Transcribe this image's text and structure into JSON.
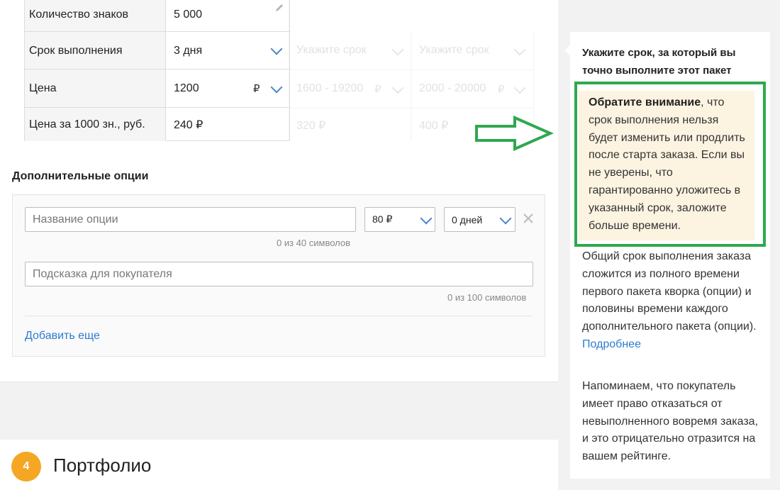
{
  "packages": {
    "rows": [
      {
        "label": "Количество знаков",
        "value": "5 000"
      },
      {
        "label": "Срок выполнения",
        "value": "3 дня"
      },
      {
        "label": "Цена",
        "value": "1200",
        "currency": "₽"
      },
      {
        "label": "Цена за 1000 зн., руб.",
        "value": "240 ₽"
      }
    ],
    "other_packages": [
      {
        "term_placeholder": "Укажите срок",
        "price_range": "1600 - 19200",
        "currency": "₽",
        "per_1000": "320 ₽"
      },
      {
        "term_placeholder": "Укажите срок",
        "price_range": "2000 - 20000",
        "currency": "₽",
        "per_1000": "400 ₽"
      }
    ]
  },
  "options": {
    "title": "Дополнительные опции",
    "name_placeholder": "Название опции",
    "name_counter": "0 из 40 символов",
    "price_select": "80 ₽",
    "days_select": "0 дней",
    "hint_placeholder": "Подсказка для покупателя",
    "hint_counter": "0 из 100 символов",
    "add_more": "Добавить еще"
  },
  "portfolio": {
    "step": "4",
    "title": "Портфолио"
  },
  "tooltip": {
    "heading": "Укажите срок, за который вы точно выполните этот пакет",
    "note_bold": "Обратите внимание",
    "note_text": ", что срок выполнения нельзя будет изменить или продлить после старта заказа. Если вы не уверены, что гарантированно уложитесь в указанный срок, заложите больше времени.",
    "para1": "Общий срок выполнения заказа сложится из полного времени первого пакета кворка (опции) и половины времени каждого дополнительного пакета (опции).",
    "para1_link": "Подробнее",
    "para2": "Напоминаем, что покупатель имеет право отказаться от невыполненного вовремя заказа, и это отрицательно отразится на вашем рейтинге."
  },
  "colors": {
    "accent_blue": "#2d7bd0",
    "highlight_green": "#2fa84f",
    "step_orange": "#f5a623",
    "note_bg": "#fdf3e1"
  }
}
